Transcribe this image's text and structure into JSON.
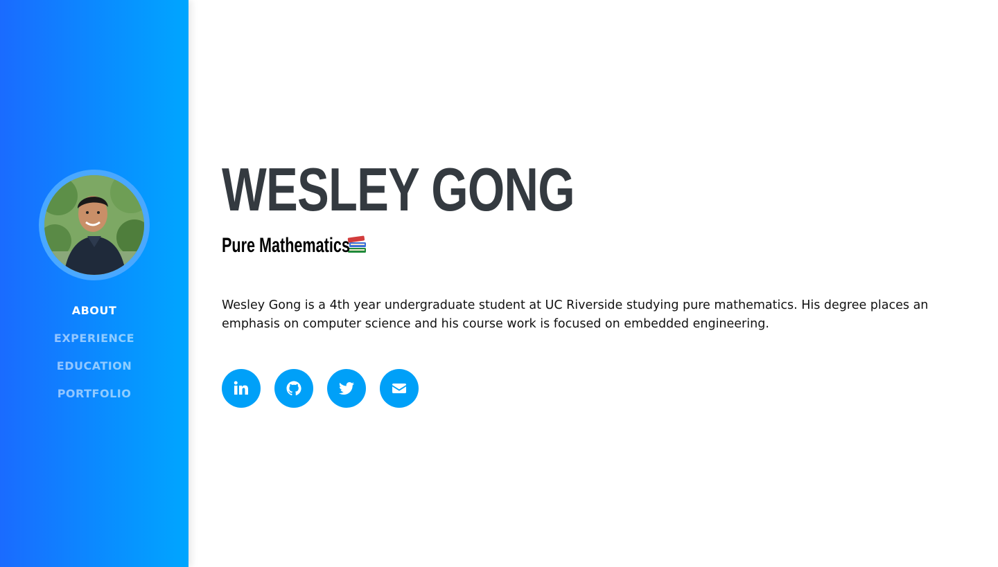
{
  "profile": {
    "name": "WESLEY GONG",
    "subtitle": "Pure Mathematics",
    "bio": "Wesley Gong is a 4th year undergraduate student at UC Riverside studying pure mathematics. His degree places an emphasis on computer science and his course work is focused on embedded engineering."
  },
  "sidebar": {
    "avatar_icon": "profile-photo",
    "nav": [
      {
        "label": "ABOUT",
        "active": true
      },
      {
        "label": "EXPERIENCE",
        "active": false
      },
      {
        "label": "EDUCATION",
        "active": false
      },
      {
        "label": "PORTFOLIO",
        "active": false
      }
    ]
  },
  "social_links": [
    {
      "icon": "linkedin-icon"
    },
    {
      "icon": "github-icon"
    },
    {
      "icon": "twitter-icon"
    },
    {
      "icon": "email-icon"
    }
  ],
  "colors": {
    "sidebar_gradient_start": "#1a6bff",
    "sidebar_gradient_end": "#00a6ff",
    "accent": "#00a0f8",
    "name_color": "#343a40"
  }
}
